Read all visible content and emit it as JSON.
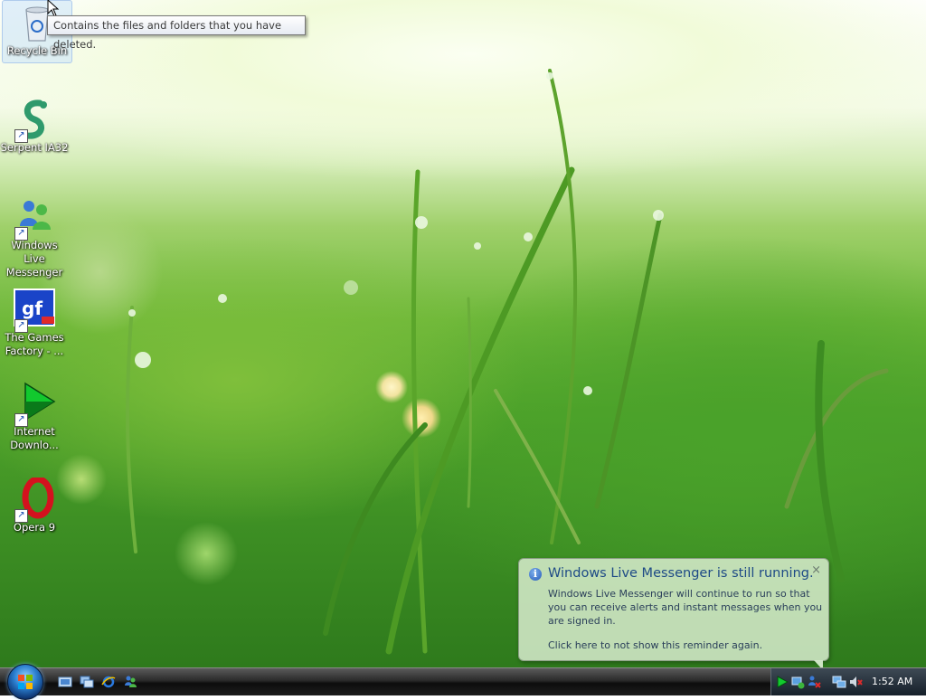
{
  "desktop": {
    "icons": [
      {
        "label": "Recycle Bin"
      },
      {
        "label": "Serpent IA32"
      },
      {
        "label": "Windows Live\nMessenger"
      },
      {
        "label": "The Games\nFactory - ..."
      },
      {
        "label": "Internet\nDownlo..."
      },
      {
        "label": "Opera 9"
      }
    ],
    "tooltip": "Contains the files and folders that you have deleted."
  },
  "notification": {
    "title": "Windows Live Messenger is still running.",
    "body": "Windows Live Messenger will continue to run so that you can receive alerts and instant messages when you are signed in.",
    "link": "Click here to not show this reminder again.",
    "close": "×"
  },
  "taskbar": {
    "clock": "1:52 AM",
    "quick_launch": [
      "show-desktop-icon",
      "switch-windows-icon",
      "internet-explorer-icon",
      "messenger-icon"
    ],
    "tray": [
      "internet-download-manager-tray-icon",
      "network-tray-icon",
      "messenger-offline-tray-icon",
      "network-connection-icon",
      "volume-muted-icon"
    ]
  },
  "colors": {
    "accent": "#1e4a86",
    "taskbar": "#1c1c1c",
    "desktop": "#4ea22a"
  }
}
